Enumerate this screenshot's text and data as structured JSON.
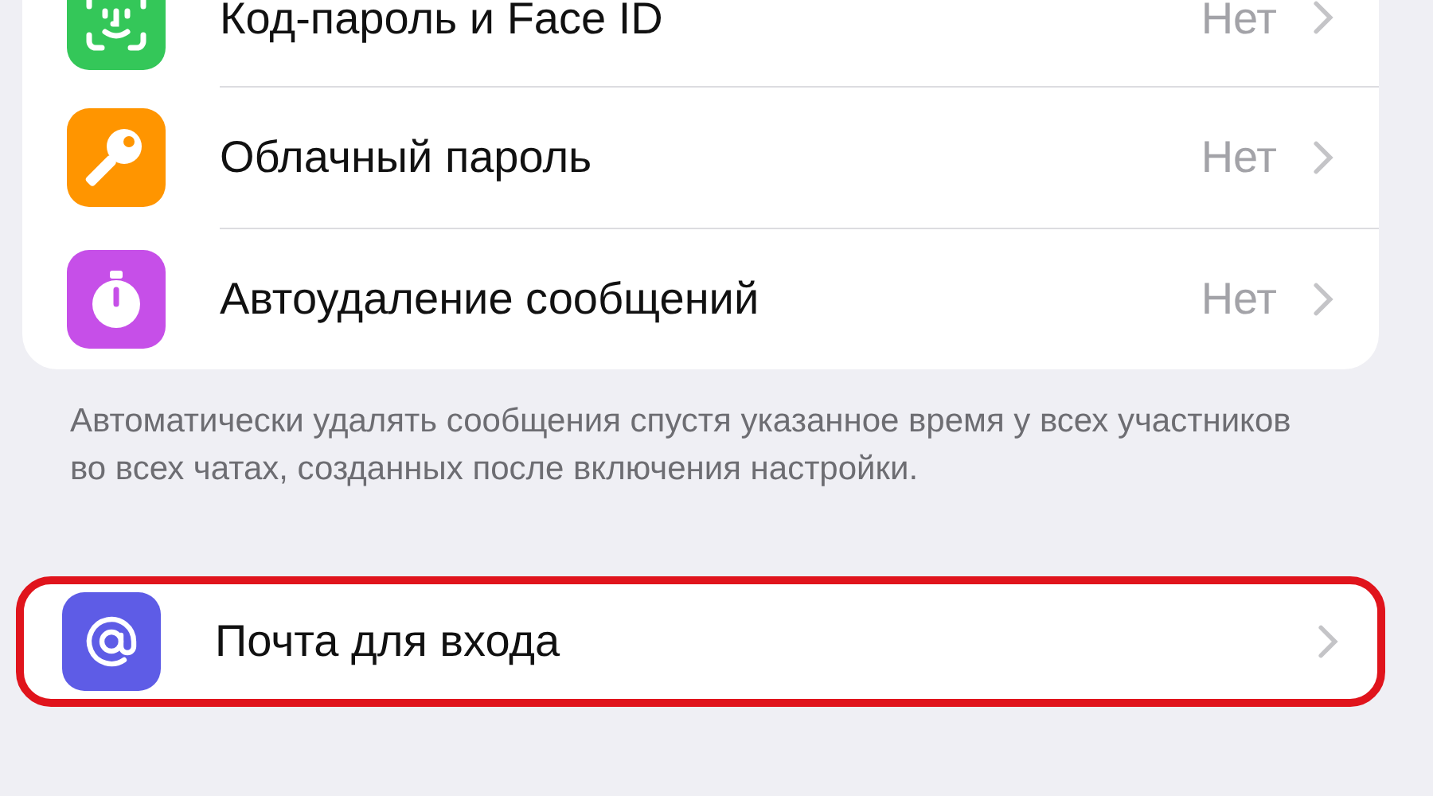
{
  "security_group": {
    "items": [
      {
        "kind": "faceid",
        "color": "#34c759",
        "label": "Код-пароль и Face ID",
        "value": "Нет"
      },
      {
        "kind": "key",
        "color": "#ff9500",
        "label": "Облачный пароль",
        "value": "Нет"
      },
      {
        "kind": "timer",
        "color": "#c64fe8",
        "label": "Автоудаление сообщений",
        "value": "Нет"
      }
    ],
    "footer": "Автоматически удалять сообщения спустя указанное время у всех участников во всех чатах, созданных после включения настройки."
  },
  "login_group": {
    "items": [
      {
        "kind": "at",
        "color": "#5e5ce6",
        "label": "Почта для входа",
        "highlighted": true
      }
    ]
  }
}
